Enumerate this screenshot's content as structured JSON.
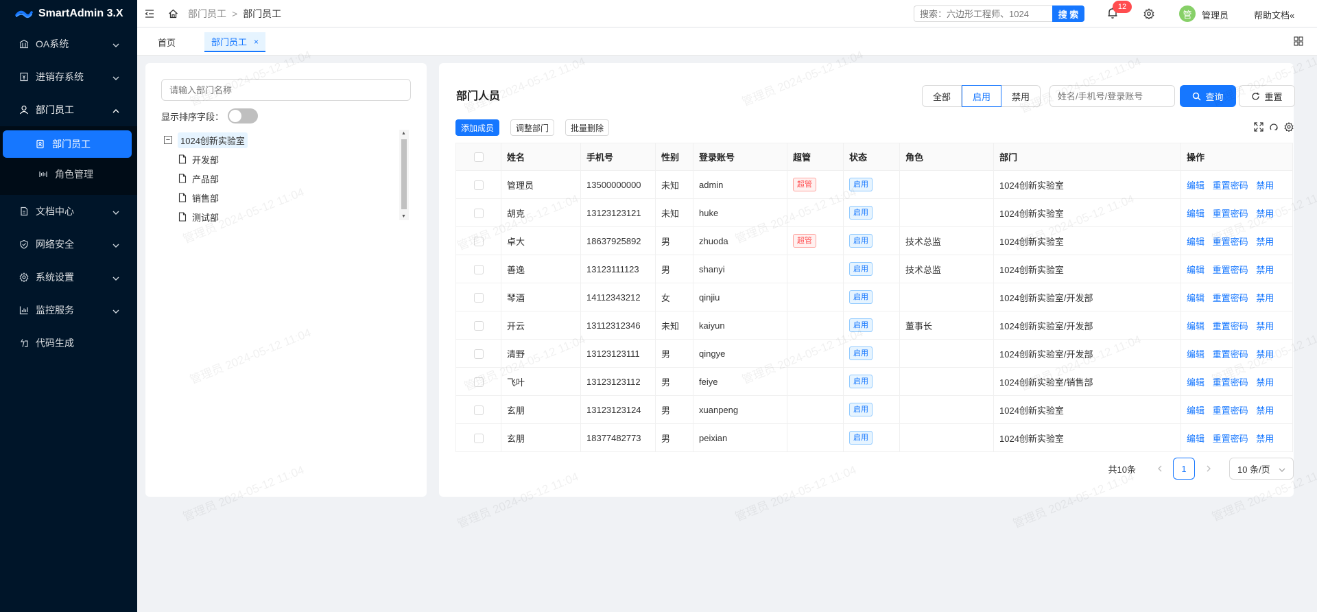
{
  "app": {
    "title": "SmartAdmin 3.X"
  },
  "sidebar": {
    "items": [
      {
        "label": "OA系统",
        "icon": "bank-icon"
      },
      {
        "label": "进销存系统",
        "icon": "account-book-icon"
      },
      {
        "label": "部门员工",
        "icon": "user-icon"
      },
      {
        "label": "文档中心",
        "icon": "file-icon"
      },
      {
        "label": "网络安全",
        "icon": "safety-icon"
      },
      {
        "label": "系统设置",
        "icon": "setting-icon"
      },
      {
        "label": "监控服务",
        "icon": "bar-chart-icon"
      },
      {
        "label": "代码生成",
        "icon": "code-icon"
      }
    ],
    "submenu": [
      {
        "label": "部门员工",
        "icon": "contacts-icon"
      },
      {
        "label": "角色管理",
        "icon": "role-icon"
      }
    ]
  },
  "header": {
    "breadcrumb": [
      "部门员工",
      "部门员工"
    ],
    "search_placeholder": "搜索：六边形工程师、1024",
    "search_button": "搜 索",
    "notification_count": "12",
    "avatar_text": "管",
    "username": "管理员",
    "help": "帮助文档«"
  },
  "tabs": [
    {
      "label": "首页"
    },
    {
      "label": "部门员工",
      "close": "×"
    }
  ],
  "dept": {
    "search_placeholder": "请输入部门名称",
    "sort_label": "显示排序字段：",
    "tree": {
      "root": "1024创新实验室",
      "children": [
        "开发部",
        "产品部",
        "销售部",
        "测试部"
      ]
    }
  },
  "employees": {
    "title": "部门人员",
    "filters": [
      "全部",
      "启用",
      "禁用"
    ],
    "active_filter": "启用",
    "keyword_placeholder": "姓名/手机号/登录账号",
    "query": "查询",
    "reset": "重置",
    "actions": [
      "添加成员",
      "调整部门",
      "批量删除"
    ],
    "columns": [
      "姓名",
      "手机号",
      "性别",
      "登录账号",
      "超管",
      "状态",
      "角色",
      "部门",
      "操作"
    ],
    "row_ops": [
      "编辑",
      "重置密码",
      "禁用"
    ],
    "rows": [
      {
        "name": "管理员",
        "phone": "13500000000",
        "gender": "未知",
        "login": "admin",
        "super": "超管",
        "status": "启用",
        "role": "",
        "dept": "1024创新实验室"
      },
      {
        "name": "胡克",
        "phone": "13123123121",
        "gender": "未知",
        "login": "huke",
        "super": "",
        "status": "启用",
        "role": "",
        "dept": "1024创新实验室"
      },
      {
        "name": "卓大",
        "phone": "18637925892",
        "gender": "男",
        "login": "zhuoda",
        "super": "超管",
        "status": "启用",
        "role": "技术总监",
        "dept": "1024创新实验室"
      },
      {
        "name": "善逸",
        "phone": "13123111123",
        "gender": "男",
        "login": "shanyi",
        "super": "",
        "status": "启用",
        "role": "技术总监",
        "dept": "1024创新实验室"
      },
      {
        "name": "琴酒",
        "phone": "14112343212",
        "gender": "女",
        "login": "qinjiu",
        "super": "",
        "status": "启用",
        "role": "",
        "dept": "1024创新实验室/开发部"
      },
      {
        "name": "开云",
        "phone": "13112312346",
        "gender": "未知",
        "login": "kaiyun",
        "super": "",
        "status": "启用",
        "role": "董事长",
        "dept": "1024创新实验室/开发部"
      },
      {
        "name": "清野",
        "phone": "13123123111",
        "gender": "男",
        "login": "qingye",
        "super": "",
        "status": "启用",
        "role": "",
        "dept": "1024创新实验室/开发部"
      },
      {
        "name": "飞叶",
        "phone": "13123123112",
        "gender": "男",
        "login": "feiye",
        "super": "",
        "status": "启用",
        "role": "",
        "dept": "1024创新实验室/销售部"
      },
      {
        "name": "玄朋",
        "phone": "13123123124",
        "gender": "男",
        "login": "xuanpeng",
        "super": "",
        "status": "启用",
        "role": "",
        "dept": "1024创新实验室"
      },
      {
        "name": "玄朋",
        "phone": "18377482773",
        "gender": "男",
        "login": "peixian",
        "super": "",
        "status": "启用",
        "role": "",
        "dept": "1024创新实验室"
      }
    ],
    "pagination": {
      "total": "共10条",
      "page": "1",
      "page_size": "10 条/页"
    }
  },
  "watermark": "管理员 2024-05-12 11:04",
  "colors": {
    "primary": "#1677ff",
    "sidebar_bg": "#001529",
    "danger": "#ff4d4f"
  }
}
